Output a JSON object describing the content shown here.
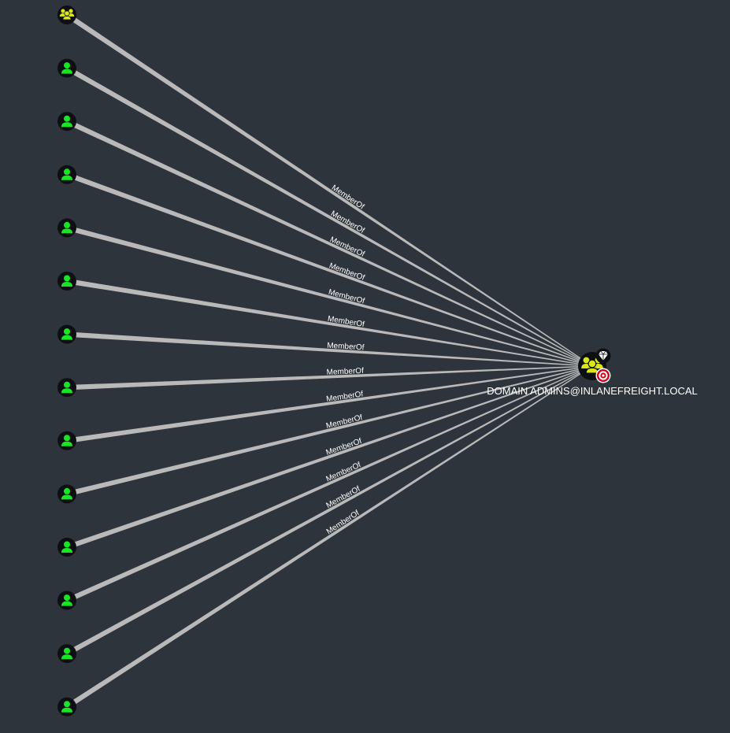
{
  "graph": {
    "background_color": "#2e343b",
    "edge_color": "#b9b9b9",
    "user_icon_color": "#17e625",
    "group_icon_color": "#dbe617",
    "target": {
      "label": "DOMAIN ADMINS@INLANEFREIGHT.LOCAL",
      "icon": "group-icon",
      "badges": [
        "diamond-icon",
        "target-icon"
      ]
    },
    "sources": [
      {
        "icon": "group-icon",
        "edge_label": "MemberOf"
      },
      {
        "icon": "user-icon",
        "edge_label": "MemberOf"
      },
      {
        "icon": "user-icon",
        "edge_label": "MemberOf"
      },
      {
        "icon": "user-icon",
        "edge_label": "MemberOf"
      },
      {
        "icon": "user-icon",
        "edge_label": "MemberOf"
      },
      {
        "icon": "user-icon",
        "edge_label": "MemberOf"
      },
      {
        "icon": "user-icon",
        "edge_label": "MemberOf"
      },
      {
        "icon": "user-icon",
        "edge_label": "MemberOf"
      },
      {
        "icon": "user-icon",
        "edge_label": "MemberOf"
      },
      {
        "icon": "user-icon",
        "edge_label": "MemberOf"
      },
      {
        "icon": "user-icon",
        "edge_label": "MemberOf"
      },
      {
        "icon": "user-icon",
        "edge_label": "MemberOf"
      },
      {
        "icon": "user-icon",
        "edge_label": "MemberOf"
      },
      {
        "icon": "user-icon",
        "edge_label": "MemberOf"
      }
    ]
  }
}
